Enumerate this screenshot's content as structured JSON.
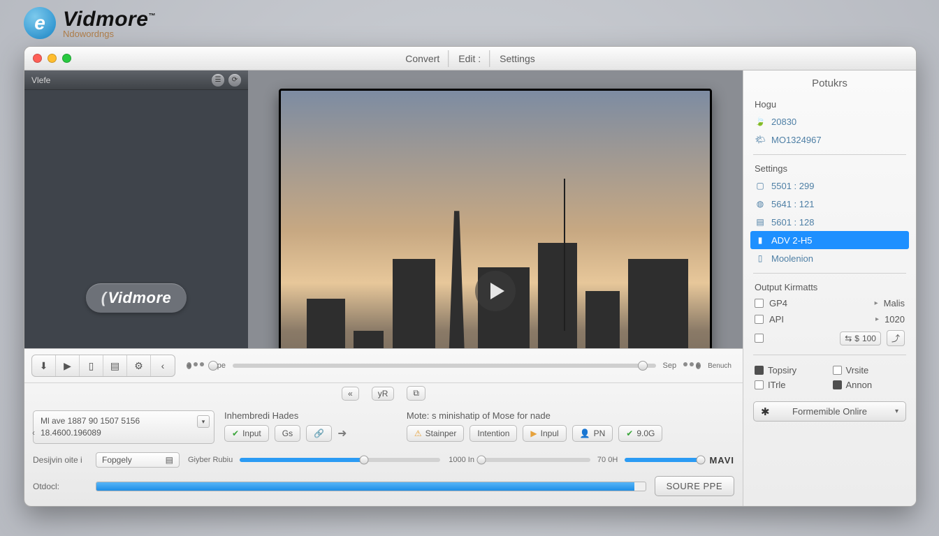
{
  "brand": {
    "name": "Vidmore",
    "tm": "™",
    "sub": "Ndowordngs"
  },
  "tabs": {
    "convert": "Convert",
    "edit": "Edit :",
    "settings": "Settings"
  },
  "leftPanel": {
    "title": "Vlefe",
    "logo": "Vidmore"
  },
  "timeline": {
    "start_label": "Tipe",
    "end_label": "Sep",
    "small": "Benuch"
  },
  "fileBox": {
    "line1": "Ml ave 1887 90 1507 5156",
    "line2": "18.4600.196089"
  },
  "colA": {
    "title": "Inhembredi Hades",
    "btn_input": "Input",
    "btn_gs": "Gs"
  },
  "colB": {
    "title": "Mote: s minishatip of Mose for nade",
    "btn_stainper": "Stainper",
    "btn_intention": "Intention",
    "btn_inpul": "Inpul",
    "btn_pn": "PN",
    "btn_9og": "9.0G"
  },
  "row3": {
    "label_design": "Desijvin oite i",
    "field_design": "Fopgely",
    "seg1_label": "Giyber Rubiu",
    "seg2_label": "1000 In",
    "seg3_label": "70 0H",
    "end_tag": "MAVI"
  },
  "row4": {
    "label": "Otdocl:",
    "button": "SOURE PPE"
  },
  "right": {
    "title": "Potukrs",
    "hogu_label": "Hogu",
    "hogu_items": [
      "20830",
      "MO1324967"
    ],
    "settings_label": "Settings",
    "settings_items": [
      "5501 : 299",
      "5641 : 121",
      "5601 : 128",
      "ADV 2-H5",
      "Moolenion"
    ],
    "settings_selected_index": 3,
    "output_label": "Output Kirmatts",
    "fmt": [
      {
        "name": "GP4",
        "right": "Malis",
        "caret": true
      },
      {
        "name": "API",
        "right": "1020",
        "caret": true
      }
    ],
    "fmt_numeric": "100",
    "checks": [
      "Topsiry",
      "Vrsite",
      "ITrle",
      "Annon"
    ],
    "combo": "Formemible Onlire"
  }
}
